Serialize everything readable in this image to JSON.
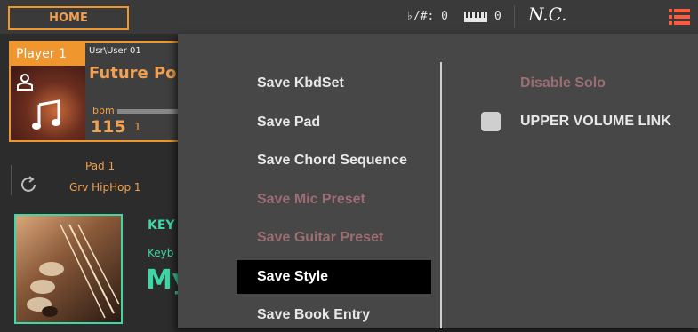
{
  "topbar": {
    "home_label": "HOME",
    "transpose_label": "♭/#: 0",
    "octave_value": "0",
    "chord": "N.C."
  },
  "player": {
    "tab_label": "Player 1",
    "path": "Usr\\User 01",
    "song_name": "Future Pop",
    "bpm_label": "bpm",
    "bpm_value": "115",
    "bar_value": "1"
  },
  "pad": {
    "title": "Pad 1",
    "name": "Grv HipHop 1"
  },
  "keyboard_set": {
    "label": "KEY",
    "sub": "Keyb",
    "name": "My"
  },
  "popup_menu": {
    "left_items": [
      {
        "label": "Save KbdSet",
        "state": "enabled"
      },
      {
        "label": "Save Pad",
        "state": "enabled"
      },
      {
        "label": "Save Chord Sequence",
        "state": "enabled"
      },
      {
        "label": "Save Mic Preset",
        "state": "disabled"
      },
      {
        "label": "Save Guitar Preset",
        "state": "disabled"
      },
      {
        "label": "Save Style",
        "state": "selected"
      },
      {
        "label": "Save Book Entry",
        "state": "enabled"
      }
    ],
    "right_items": [
      {
        "label": "Disable Solo",
        "state": "disabled"
      },
      {
        "label": "UPPER VOLUME LINK",
        "checked": false
      }
    ]
  },
  "colors": {
    "accent_orange": "#f0962e",
    "accent_teal": "#3ed7a7",
    "disabled_text": "#9b6f72",
    "menu_icon": "#ff5a3c"
  }
}
